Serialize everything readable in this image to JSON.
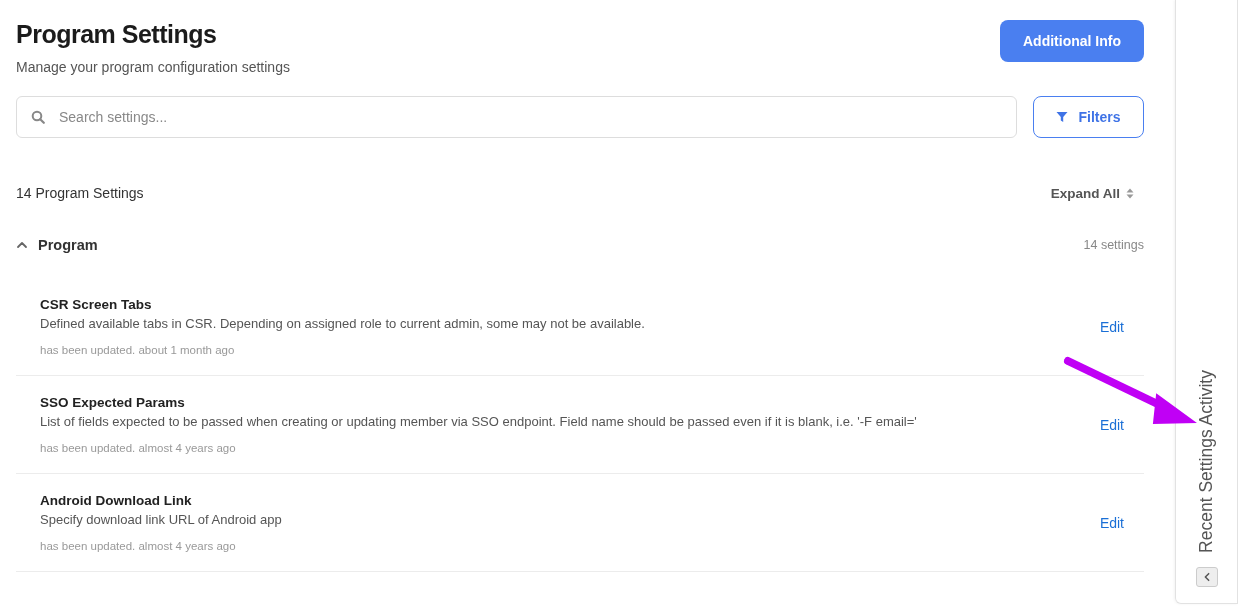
{
  "header": {
    "title": "Program Settings",
    "subtitle": "Manage your program configuration settings",
    "action_button": "Additional Info"
  },
  "search": {
    "placeholder": "Search settings..."
  },
  "filters_button": "Filters",
  "summary": {
    "count_label": "14 Program Settings",
    "expand_all": "Expand All"
  },
  "groups": [
    {
      "name": "Program",
      "count": "14 settings",
      "expanded": true,
      "settings": [
        {
          "name": "CSR Screen Tabs",
          "description": "Defined available tabs in CSR. Depending on assigned role to current admin, some may not be available.",
          "updated": "has been updated. about 1 month ago",
          "action": "Edit"
        },
        {
          "name": "SSO Expected Params",
          "description": "List of fields expected to be passed when creating or updating member via SSO endpoint. Field name should be passed even if it is blank, i.e. '-F email='",
          "updated": "has been updated. almost 4 years ago",
          "action": "Edit"
        },
        {
          "name": "Android Download Link",
          "description": "Specify download link URL of Android app",
          "updated": "has been updated. almost 4 years ago",
          "action": "Edit"
        }
      ]
    }
  ],
  "activity_panel": {
    "title": "Recent Settings Activity",
    "expanded": false
  }
}
